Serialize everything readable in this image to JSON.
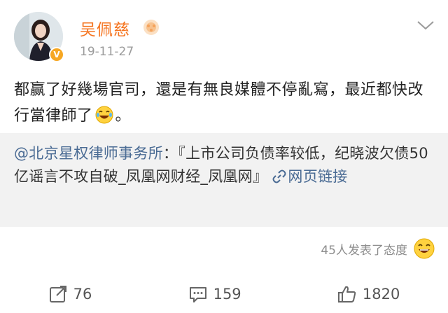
{
  "user": {
    "name": "吴佩慈",
    "timestamp": "19-11-27",
    "verified_color": "#f6a723",
    "name_color": "#f5741f"
  },
  "post": {
    "text_before_emoji": "都赢了好幾場官司，還是有無良媒體不停亂寫，最近都快改行當律師了",
    "emoji": "laugh-cry-emoji",
    "text_after_emoji": "。"
  },
  "quote": {
    "mention": "@北京星权律师事务所",
    "body": "：『上市公司负债率较低，纪晓波欠债50亿谣言不攻自破_凤凰网财经_凤凰网』",
    "link_label": "网页链接",
    "link_color": "#4a6b94"
  },
  "reactions": {
    "text": "45人发表了态度",
    "icon": "laugh-emoji"
  },
  "actions": {
    "repost_count": "76",
    "comment_count": "159",
    "like_count": "1820"
  }
}
